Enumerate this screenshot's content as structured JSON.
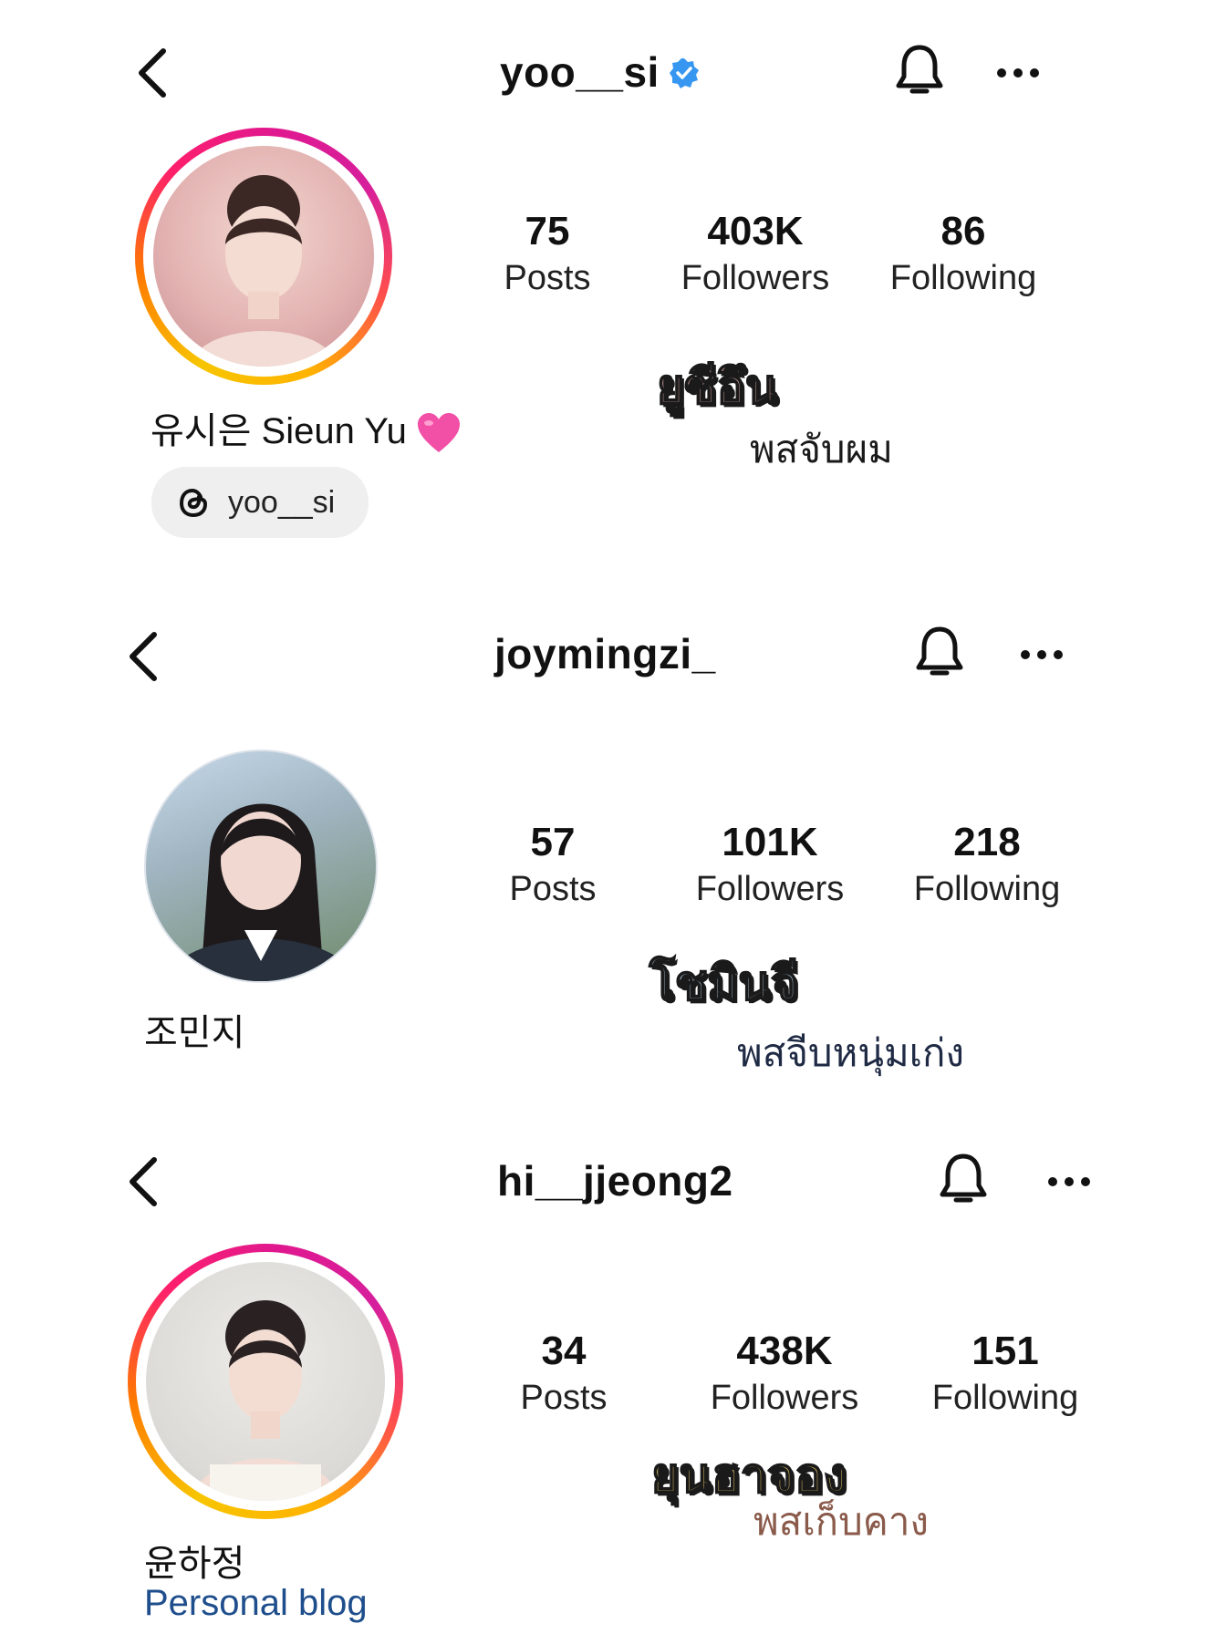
{
  "profiles": [
    {
      "username": "yoo__si",
      "verified": true,
      "stats": [
        {
          "value": "75",
          "label": "Posts"
        },
        {
          "value": "403K",
          "label": "Followers"
        },
        {
          "value": "86",
          "label": "Following"
        }
      ],
      "full_name": "유시은 Sieun Yu",
      "name_emoji": "pink-heart",
      "threads_handle": "yoo__si",
      "overlay_title": "ยูซีอึน",
      "overlay_subtitle": "พสจับผม",
      "story_ring": true
    },
    {
      "username": "joymingzi_",
      "verified": false,
      "stats": [
        {
          "value": "57",
          "label": "Posts"
        },
        {
          "value": "101K",
          "label": "Followers"
        },
        {
          "value": "218",
          "label": "Following"
        }
      ],
      "full_name": "조민지",
      "overlay_title": "โชมินจี",
      "overlay_subtitle": "พสจีบหนุ่มเก่ง",
      "story_ring": false
    },
    {
      "username": "hi__jjeong2",
      "verified": false,
      "stats": [
        {
          "value": "34",
          "label": "Posts"
        },
        {
          "value": "438K",
          "label": "Followers"
        },
        {
          "value": "151",
          "label": "Following"
        }
      ],
      "full_name": "윤하정",
      "category": "Personal blog",
      "overlay_title": "ยุนฮาจอง",
      "overlay_subtitle": "พสเก็บคาง",
      "story_ring": true
    }
  ],
  "colors": {
    "verified_blue": "#3797f0",
    "link_blue": "#1f4e8c",
    "chip_bg": "#efefef",
    "overlay_title_fill_1": "#d9a7a7",
    "overlay_title_fill_2": "#9fb7c9",
    "overlay_title_fill_3": "#f3d26b",
    "overlay_subtitle_3": "#8a5a4a"
  },
  "icons": [
    "back-chevron-icon",
    "verified-badge-icon",
    "bell-icon",
    "more-options-icon",
    "threads-icon",
    "pink-heart-emoji"
  ]
}
